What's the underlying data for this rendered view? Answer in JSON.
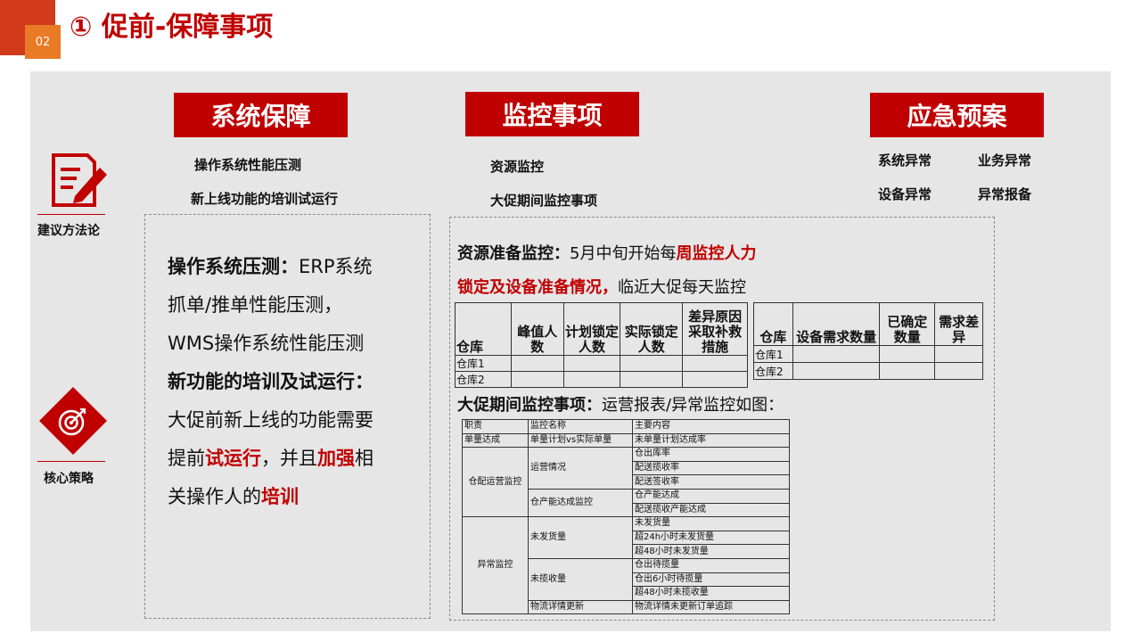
{
  "page_number": "02",
  "title": "① 促前-保障事项",
  "sections": {
    "system": {
      "label": "系统保障",
      "items": [
        "操作系统性能压测",
        "新上线功能的培训试运行"
      ]
    },
    "monitor": {
      "label": "监控事项",
      "items": [
        "资源监控",
        "大促期间监控事项"
      ]
    },
    "emergency": {
      "label": "应急预案",
      "items": [
        "系统异常",
        "业务异常",
        "设备异常",
        "异常报备"
      ]
    }
  },
  "icons": {
    "methodology": {
      "label": "建议方法论",
      "icon": "document-pen-icon"
    },
    "strategy": {
      "label": "核心策略",
      "icon": "target-icon"
    }
  },
  "left_detail": {
    "p1_bold": "操作系统压测：",
    "p1_text": "ERP系统抓单/推单性能压测，WMS操作系统性能压测",
    "p2_bold": "新功能的培训及试运行：",
    "p2_t1": "大促前新上线的功能需要提前",
    "p2_r1": "试运行",
    "p2_t2": "，并且",
    "p2_r2": "加强",
    "p2_t3": "相关操作人的",
    "p2_r3": "培训"
  },
  "resource": {
    "bold": "资源准备监控：",
    "t1": "5月中旬开始每",
    "r1": "周监控人力",
    "r2": "锁定及设备准备情况，",
    "t2": "临近大促每天监控"
  },
  "table1": {
    "headers": [
      "仓库",
      "峰值人数",
      "计划锁定人数",
      "实际锁定人数",
      "差异原因采取补救措施"
    ],
    "rows": [
      "仓库1",
      "仓库2"
    ]
  },
  "table2": {
    "headers": [
      "仓库",
      "设备需求数量",
      "已确定数量",
      "需求差异"
    ],
    "rows": [
      "仓库1",
      "仓库2"
    ]
  },
  "promo": {
    "bold": "大促期间监控事项：",
    "text": "运营报表/异常监控如图："
  },
  "table3": {
    "headers": [
      "职责",
      "监控名称",
      "主要内容"
    ],
    "r1": [
      "单量达成",
      "单量计划vs实际单量",
      "未单量计划达成率"
    ],
    "g2": "仓配运营监控",
    "g2a": "运营情况",
    "g2a_items": [
      "仓出库率",
      "配送揽收率",
      "配送签收率"
    ],
    "g2b": "仓产能达成监控",
    "g2b_items": [
      "仓产能达成",
      "配送揽收产能达成"
    ],
    "g3": "异常监控",
    "g3a": "未发货量",
    "g3a_items": [
      "未发货量",
      "超24h小时未发货量",
      "超48小时未发货量"
    ],
    "g3b": "未揽收量",
    "g3b_items": [
      "仓出待揽量",
      "仓出6小时待揽量",
      "超48小时未揽收量"
    ],
    "g3c": "物流详情更新",
    "g3c_item": "物流详情未更新订单追踪"
  }
}
